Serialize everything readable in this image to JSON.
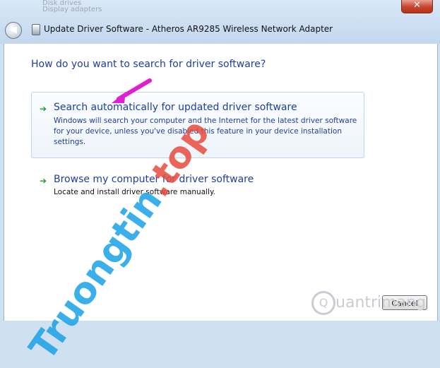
{
  "titlebar": {
    "window_title": "Update Driver Software - Atheros AR9285 Wireless Network Adapter",
    "close_label": "✕"
  },
  "behind_window": {
    "lines": [
      "Disk drives",
      "Display adapters"
    ]
  },
  "content": {
    "question": "How do you want to search for driver software?",
    "options": [
      {
        "title": "Search automatically for updated driver software",
        "description": "Windows will search your computer and the Internet for the latest driver software for your device, unless you've disabled this feature in your device installation settings."
      },
      {
        "title": "Browse my computer for driver software",
        "description": "Locate and install driver software manually."
      }
    ]
  },
  "footer": {
    "cancel_label": "Cancel"
  },
  "watermarks": {
    "truongtin_main": "Truongtin",
    "truongtin_suffix": ".top",
    "quantrimang": "uantrimang"
  },
  "colors": {
    "accent_blue": "#1e3f9e",
    "arrow_green": "#1a9b3a",
    "annotation_pink": "#e020d0"
  }
}
